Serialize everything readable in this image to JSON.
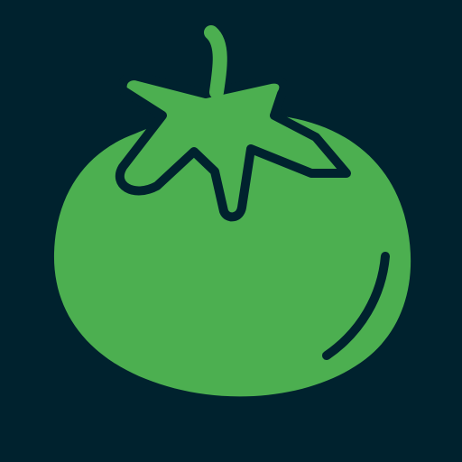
{
  "icon": {
    "name": "tomato-icon",
    "colors": {
      "background": "#00222e",
      "fruit": "#4caf50",
      "leaves": "#4caf50",
      "outline": "#00222e"
    }
  }
}
